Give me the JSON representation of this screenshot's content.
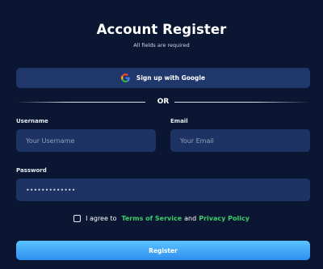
{
  "header": {
    "title": "Account Register",
    "subtitle": "All fields are required"
  },
  "google_button": {
    "label": "Sign up with Google",
    "icon": "google-icon"
  },
  "divider": {
    "text": "OR"
  },
  "form": {
    "username": {
      "label": "Username",
      "placeholder": "Your Username",
      "value": ""
    },
    "email": {
      "label": "Email",
      "placeholder": "Your Email",
      "value": ""
    },
    "password": {
      "label": "Password",
      "value": "•••••••••••••"
    }
  },
  "agreement": {
    "prefix": "I agree to",
    "terms_link": "Terms of Service",
    "conjunction": "and",
    "privacy_link": "Privacy Policy",
    "checked": false
  },
  "register_button": {
    "label": "Register"
  },
  "colors": {
    "background": "#0b1732",
    "field": "#1d3363",
    "google_button": "#1f376b",
    "link": "#3fce6b",
    "register_gradient_top": "#5ac3ff",
    "register_gradient_bottom": "#2f8ff0"
  }
}
